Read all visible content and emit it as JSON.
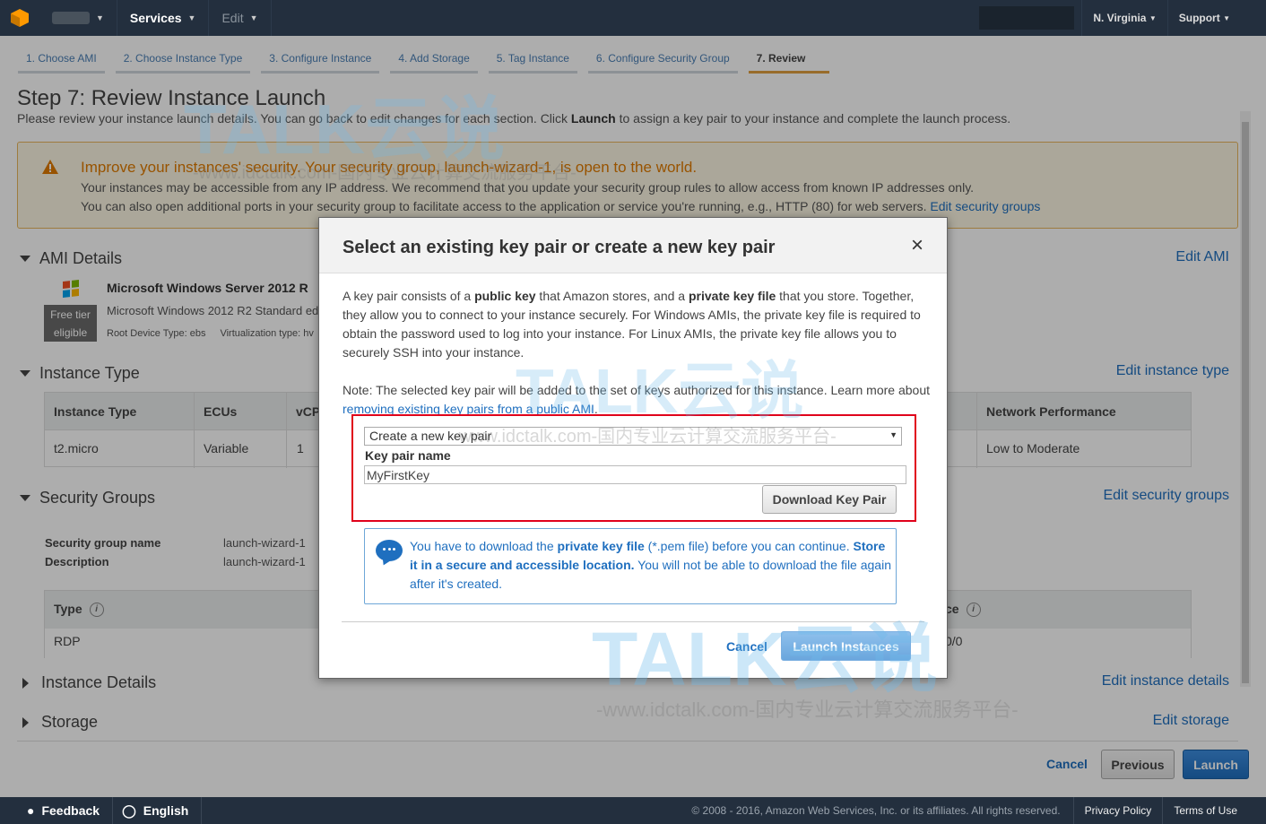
{
  "nav": {
    "account": "AWS",
    "services": "Services",
    "edit": "Edit",
    "region": "N. Virginia",
    "support": "Support"
  },
  "steps": [
    {
      "label": "1. Choose AMI"
    },
    {
      "label": "2. Choose Instance Type"
    },
    {
      "label": "3. Configure Instance"
    },
    {
      "label": "4. Add Storage"
    },
    {
      "label": "5. Tag Instance"
    },
    {
      "label": "6. Configure Security Group"
    },
    {
      "label": "7. Review"
    }
  ],
  "page": {
    "title": "Step 7: Review Instance Launch",
    "subtitle_pre": "Please review your instance launch details. You can go back to edit changes for each section. Click ",
    "subtitle_bold": "Launch",
    "subtitle_post": " to assign a key pair to your instance and complete the launch process."
  },
  "warning": {
    "title": "Improve your instances' security. Your security group, launch-wizard-1, is open to the world.",
    "line1": "Your instances may be accessible from any IP address. We recommend that you update your security group rules to allow access from known IP addresses only.",
    "line2": "You can also open additional ports in your security group to facilitate access to the application or service you're running, e.g., HTTP (80) for web servers.",
    "link": "Edit security groups"
  },
  "ami": {
    "heading": "AMI Details",
    "edit": "Edit AMI",
    "name": "Microsoft Windows Server 2012 R",
    "desc": "Microsoft Windows 2012 R2 Standard ed",
    "root_device": "Root Device Type: ebs",
    "virtualization": "Virtualization type: hv",
    "free_tier_1": "Free tier",
    "free_tier_2": "eligible"
  },
  "instance_type": {
    "heading": "Instance Type",
    "edit": "Edit instance type",
    "headers": [
      "Instance Type",
      "ECUs",
      "vCP",
      "Network Performance"
    ],
    "row": [
      "t2.micro",
      "Variable",
      "1",
      "Low to Moderate"
    ]
  },
  "security_groups": {
    "heading": "Security Groups",
    "edit": "Edit security groups",
    "name_label": "Security group name",
    "name_value": "launch-wizard-1",
    "desc_label": "Description",
    "desc_value": "launch-wizard-1",
    "col_type": "Type",
    "col_source_tail": "ce",
    "row_type": "RDP",
    "row_source_tail": "0/0"
  },
  "instance_details": {
    "heading": "Instance Details",
    "edit": "Edit instance details"
  },
  "storage": {
    "heading": "Storage",
    "edit": "Edit storage"
  },
  "actions": {
    "cancel": "Cancel",
    "previous": "Previous",
    "launch": "Launch"
  },
  "footer": {
    "feedback": "Feedback",
    "language": "English",
    "copyright": "© 2008 - 2016, Amazon Web Services, Inc. or its affiliates. All rights reserved.",
    "privacy": "Privacy Policy",
    "terms": "Terms of Use"
  },
  "modal": {
    "title": "Select an existing key pair or create a new key pair",
    "close": "×",
    "p1_a": "A key pair consists of a ",
    "p1_b": "public key",
    "p1_c": " that Amazon stores, and a ",
    "p1_d": "private key file",
    "p1_e": " that you store. Together, they allow you to connect to your instance securely. For Windows AMIs, the private key file is required to obtain the password used to log into your instance. For Linux AMIs, the private key file allows you to securely SSH into your instance.",
    "p2_a": "Note: The selected key pair will be added to the set of keys authorized for this instance. Learn more about ",
    "p2_link": "removing existing key pairs from a public AMI",
    "p2_b": ".",
    "select_value": "Create a new key pair",
    "key_label": "Key pair name",
    "key_value": "MyFirstKey",
    "download": "Download Key Pair",
    "info_a": "You have to download the ",
    "info_b": "private key file",
    "info_c": " (*.pem file) before you can continue. ",
    "info_d": "Store it in a secure and accessible location.",
    "info_e": " You will not be able to download the file again after it's created.",
    "cancel": "Cancel",
    "launch": "Launch Instances"
  },
  "watermark": {
    "brand": "TALK云说",
    "url": "-www.idctalk.com-国内专业云计算交流服务平台-"
  },
  "colors": {
    "nav_bg": "#232f3e",
    "link": "#1f6fbf",
    "warning": "#e07b00",
    "highlight": "#e0001b",
    "primary_btn": "#1f6fbf"
  }
}
